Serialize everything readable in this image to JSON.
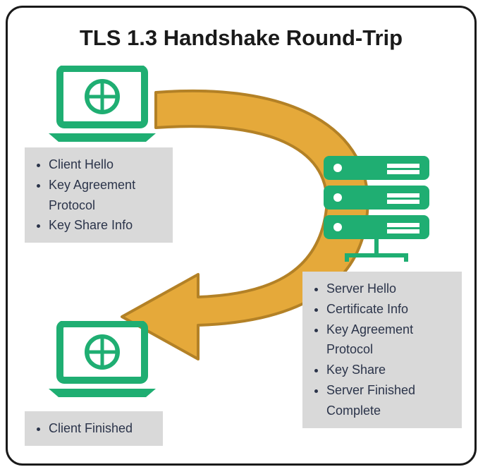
{
  "title": "TLS 1.3 Handshake Round-Trip",
  "client_send": {
    "items": [
      "Client Hello",
      "Key Agreement Protocol",
      "Key Share Info"
    ]
  },
  "server_reply": {
    "items": [
      "Server Hello",
      "Certificate Info",
      "Key Agreement Protocol",
      "Key Share",
      "Server Finished Complete"
    ]
  },
  "client_done": {
    "items": [
      "Client Finished"
    ]
  },
  "colors": {
    "accent": "#1fae72",
    "arrow_fill": "#e5a93a",
    "arrow_stroke": "#b38126",
    "box": "#d9d9d9",
    "text": "#2b344a"
  }
}
